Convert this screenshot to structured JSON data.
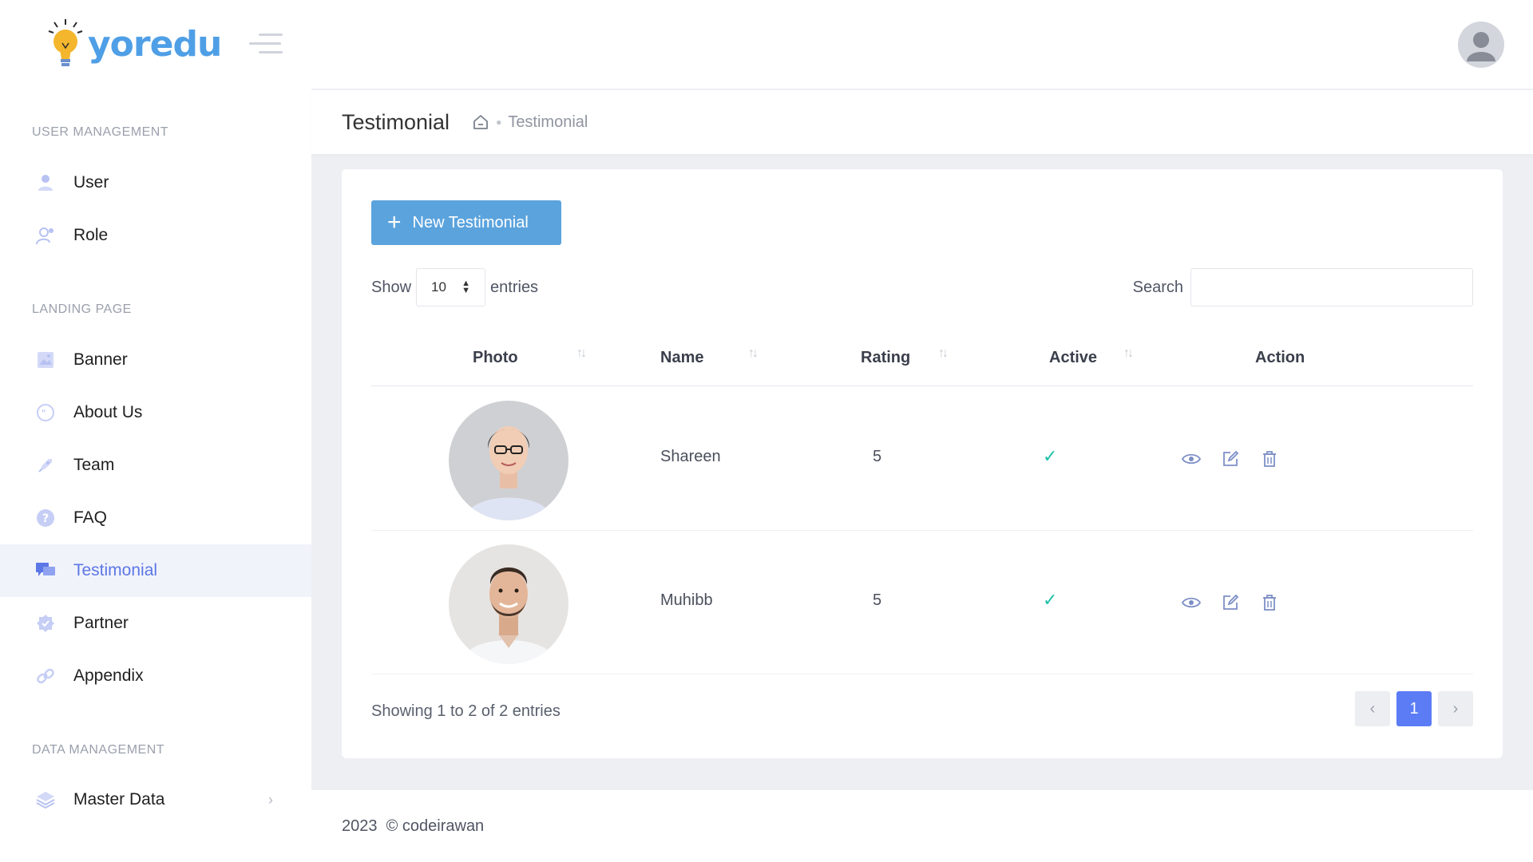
{
  "brand": {
    "name": "yoredu"
  },
  "sidebar": {
    "sections": [
      {
        "title": "USER MANAGEMENT"
      },
      {
        "title": "LANDING PAGE"
      },
      {
        "title": "DATA MANAGEMENT"
      }
    ],
    "items": [
      {
        "label": "User",
        "icon": "user-icon"
      },
      {
        "label": "Role",
        "icon": "role-icon"
      },
      {
        "label": "Banner",
        "icon": "banner-icon"
      },
      {
        "label": "About Us",
        "icon": "about-icon"
      },
      {
        "label": "Team",
        "icon": "rocket-icon"
      },
      {
        "label": "FAQ",
        "icon": "question-icon"
      },
      {
        "label": "Testimonial",
        "icon": "chat-icon",
        "active": true
      },
      {
        "label": "Partner",
        "icon": "badge-icon"
      },
      {
        "label": "Appendix",
        "icon": "link-icon"
      },
      {
        "label": "Master Data",
        "icon": "layers-icon",
        "chevron": "›"
      }
    ]
  },
  "page": {
    "title": "Testimonial",
    "breadcrumb": {
      "current": "Testimonial"
    }
  },
  "toolbar": {
    "new_label": "New Testimonial"
  },
  "table_controls": {
    "show_label": "Show",
    "page_size": "10",
    "entries_label": "entries",
    "search_label": "Search",
    "search_value": ""
  },
  "table": {
    "columns": [
      "Photo",
      "Name",
      "Rating",
      "Active",
      "Action"
    ],
    "rows": [
      {
        "name": "Shareen",
        "rating": "5",
        "active": true
      },
      {
        "name": "Muhibb",
        "rating": "5",
        "active": true
      }
    ]
  },
  "pagination": {
    "info": "Showing 1 to 2 of 2 entries",
    "current": "1",
    "prev": "‹",
    "next": "›"
  },
  "footer": {
    "text": "2023  © codeirawan"
  },
  "colors": {
    "accent": "#5b7cf5",
    "button": "#5ba3dd",
    "check": "#1ec0a8",
    "brand": "#4f9fe6"
  }
}
